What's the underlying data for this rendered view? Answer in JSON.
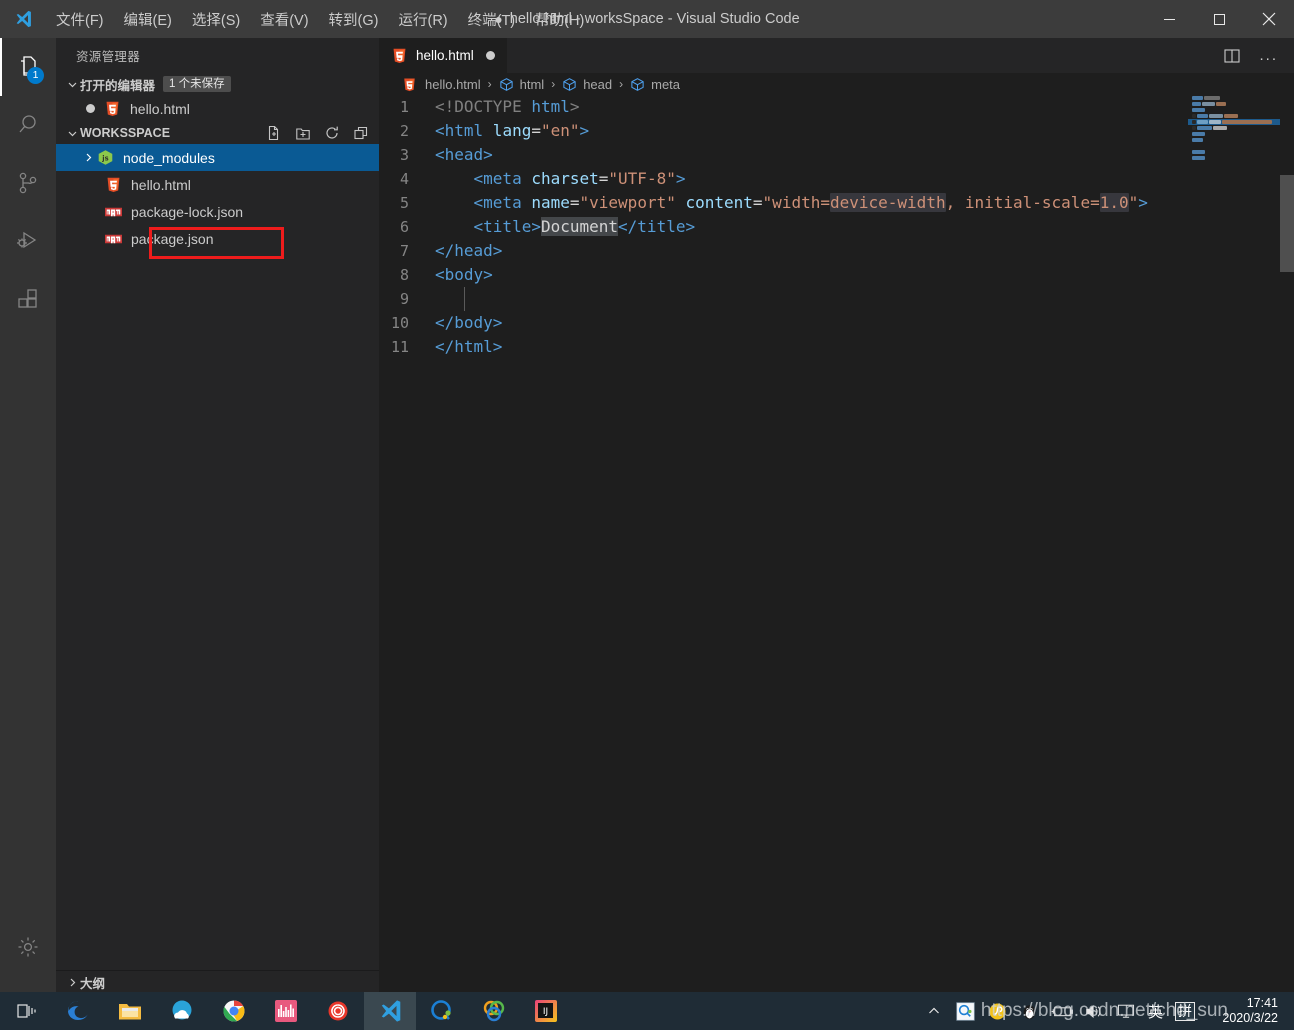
{
  "window": {
    "title": "hello.html - worksSpace - Visual Studio Code",
    "dirty_marker": "●",
    "app_icon": "vscode-logo-icon",
    "minimize_label": "最小化",
    "maximize_label": "最大化",
    "close_label": "关闭"
  },
  "menubar": {
    "items": [
      {
        "label": "文件(F)",
        "name": "menu-file"
      },
      {
        "label": "编辑(E)",
        "name": "menu-edit"
      },
      {
        "label": "选择(S)",
        "name": "menu-selection"
      },
      {
        "label": "查看(V)",
        "name": "menu-view"
      },
      {
        "label": "转到(G)",
        "name": "menu-go"
      },
      {
        "label": "运行(R)",
        "name": "menu-run"
      },
      {
        "label": "终端(T)",
        "name": "menu-terminal"
      },
      {
        "label": "帮助(H)",
        "name": "menu-help"
      }
    ]
  },
  "activitybar": {
    "items": [
      {
        "name": "activity-explorer",
        "icon": "files-icon",
        "active": true,
        "badge": "1"
      },
      {
        "name": "activity-search",
        "icon": "search-icon",
        "active": false,
        "badge": ""
      },
      {
        "name": "activity-source-control",
        "icon": "source-control-icon",
        "active": false,
        "badge": ""
      },
      {
        "name": "activity-run-debug",
        "icon": "run-debug-icon",
        "active": false,
        "badge": ""
      },
      {
        "name": "activity-extensions",
        "icon": "extensions-icon",
        "active": false,
        "badge": ""
      }
    ],
    "settings": {
      "name": "activity-settings",
      "icon": "gear-icon"
    }
  },
  "sidebar": {
    "title": "资源管理器",
    "open_editors": {
      "label": "打开的编辑器",
      "badge": "1 个未保存",
      "items": [
        {
          "label": "hello.html",
          "icon": "html5-icon",
          "unsaved": true
        }
      ]
    },
    "workspace": {
      "label": "WORKSSPACE",
      "actions": [
        {
          "name": "new-file-button",
          "icon": "new-file-icon"
        },
        {
          "name": "new-folder-button",
          "icon": "new-folder-icon"
        },
        {
          "name": "refresh-explorer-button",
          "icon": "refresh-icon"
        },
        {
          "name": "collapse-folders-button",
          "icon": "collapse-all-icon"
        }
      ],
      "items": [
        {
          "label": "node_modules",
          "icon": "node-folder-icon",
          "type": "folder",
          "selected": true,
          "expanded": false
        },
        {
          "label": "hello.html",
          "icon": "html5-icon",
          "type": "file",
          "selected": false,
          "highlighted": true
        },
        {
          "label": "package-lock.json",
          "icon": "npm-icon",
          "type": "file",
          "selected": false
        },
        {
          "label": "package.json",
          "icon": "npm-icon",
          "type": "file",
          "selected": false
        }
      ]
    },
    "outline": {
      "label": "大纲"
    }
  },
  "editor": {
    "tab": {
      "label": "hello.html",
      "icon": "html5-icon",
      "dirty": true
    },
    "actions": [
      {
        "name": "split-editor-button",
        "icon": "split-editor-icon"
      },
      {
        "name": "more-actions-button",
        "icon": "ellipsis-icon",
        "label": "..."
      }
    ],
    "breadcrumbs": [
      {
        "label": "hello.html",
        "icon": "html5-icon"
      },
      {
        "label": "html",
        "icon": "symbol-cube-icon"
      },
      {
        "label": "head",
        "icon": "symbol-cube-icon"
      },
      {
        "label": "meta",
        "icon": "symbol-cube-icon"
      }
    ],
    "lines": [
      {
        "num": "1",
        "tokens": [
          {
            "t": "<!DOCTYPE ",
            "c": "doctype"
          },
          {
            "t": "html",
            "c": "tag"
          },
          {
            "t": ">",
            "c": "doctype"
          }
        ]
      },
      {
        "num": "2",
        "tokens": [
          {
            "t": "<html",
            "c": "tag"
          },
          {
            "t": " lang",
            "c": "attr"
          },
          {
            "t": "=",
            "c": "plain"
          },
          {
            "t": "\"en\"",
            "c": "str"
          },
          {
            "t": ">",
            "c": "tag"
          }
        ]
      },
      {
        "num": "3",
        "tokens": [
          {
            "t": "<head>",
            "c": "tag"
          }
        ]
      },
      {
        "num": "4",
        "tokens": [
          {
            "t": "    <meta",
            "c": "tag"
          },
          {
            "t": " charset",
            "c": "attr"
          },
          {
            "t": "=",
            "c": "plain"
          },
          {
            "t": "\"UTF-8\"",
            "c": "str"
          },
          {
            "t": ">",
            "c": "tag"
          }
        ]
      },
      {
        "num": "5",
        "tokens": [
          {
            "t": "    <meta",
            "c": "tag"
          },
          {
            "t": " name",
            "c": "attr"
          },
          {
            "t": "=",
            "c": "plain"
          },
          {
            "t": "\"viewport\"",
            "c": "str"
          },
          {
            "t": " content",
            "c": "attr"
          },
          {
            "t": "=",
            "c": "plain"
          },
          {
            "t": "\"width=",
            "c": "str"
          },
          {
            "t": "device-width",
            "c": "str wordhl"
          },
          {
            "t": ", initial-scale=",
            "c": "str"
          },
          {
            "t": "1.0",
            "c": "str wordhl"
          },
          {
            "t": "\"",
            "c": "str"
          },
          {
            "t": ">",
            "c": "tag"
          }
        ]
      },
      {
        "num": "6",
        "tokens": [
          {
            "t": "    <title>",
            "c": "tag"
          },
          {
            "t": "Document",
            "c": "plain selhl"
          },
          {
            "t": "</title>",
            "c": "tag"
          }
        ]
      },
      {
        "num": "7",
        "tokens": [
          {
            "t": "</head>",
            "c": "tag"
          }
        ]
      },
      {
        "num": "8",
        "tokens": [
          {
            "t": "<body>",
            "c": "tag"
          }
        ]
      },
      {
        "num": "9",
        "tokens": [
          {
            "t": "",
            "c": "plain"
          }
        ],
        "indent_guide": true
      },
      {
        "num": "10",
        "tokens": [
          {
            "t": "</body>",
            "c": "tag"
          }
        ]
      },
      {
        "num": "11",
        "tokens": [
          {
            "t": "</html>",
            "c": "tag"
          }
        ]
      }
    ],
    "minimap": {
      "name": "minimap",
      "rows": [
        {
          "blocks": [
            {
              "w": 11,
              "c": "#4a7ba8"
            },
            {
              "w": 16,
              "c": "#6b6b6b"
            }
          ]
        },
        {
          "blocks": [
            {
              "w": 9,
              "c": "#4a7ba8"
            },
            {
              "w": 13,
              "c": "#7a8fa0"
            },
            {
              "w": 10,
              "c": "#9a6f52"
            }
          ]
        },
        {
          "blocks": [
            {
              "w": 13,
              "c": "#4a7ba8"
            }
          ]
        },
        {
          "blocks": [
            {
              "w": 4,
              "c": "#2a2a2a"
            },
            {
              "w": 11,
              "c": "#4a7ba8"
            },
            {
              "w": 14,
              "c": "#7a8fa0"
            },
            {
              "w": 14,
              "c": "#9a6f52"
            }
          ]
        },
        {
          "selected": true,
          "blocks": [
            {
              "w": 4,
              "c": "#2a2a2a"
            },
            {
              "w": 11,
              "c": "#6d9ec4"
            },
            {
              "w": 12,
              "c": "#9fb5c6"
            },
            {
              "w": 50,
              "c": "#9a6f52"
            }
          ]
        },
        {
          "blocks": [
            {
              "w": 4,
              "c": "#2a2a2a"
            },
            {
              "w": 15,
              "c": "#4a7ba8"
            },
            {
              "w": 14,
              "c": "#a9a9a9"
            }
          ]
        },
        {
          "blocks": [
            {
              "w": 13,
              "c": "#4a7ba8"
            }
          ]
        },
        {
          "blocks": [
            {
              "w": 11,
              "c": "#4a7ba8"
            }
          ]
        },
        {
          "blocks": []
        },
        {
          "blocks": [
            {
              "w": 13,
              "c": "#4a7ba8"
            }
          ]
        },
        {
          "blocks": [
            {
              "w": 13,
              "c": "#4a7ba8"
            }
          ]
        }
      ]
    }
  },
  "taskbar": {
    "items": [
      {
        "name": "taskview-button",
        "icon": "task-view-icon"
      },
      {
        "name": "taskbar-edge",
        "icon": "edge-icon"
      },
      {
        "name": "taskbar-file-explorer",
        "icon": "file-explorer-icon"
      },
      {
        "name": "taskbar-weather-app",
        "icon": "cloud-app-icon"
      },
      {
        "name": "taskbar-chrome",
        "icon": "chrome-icon"
      },
      {
        "name": "taskbar-bilibili",
        "icon": "bilibili-icon"
      },
      {
        "name": "taskbar-snail-app",
        "icon": "snail-icon"
      },
      {
        "name": "taskbar-vscode",
        "icon": "vscode-icon",
        "active": true
      },
      {
        "name": "taskbar-qq-browser",
        "icon": "qq-browser-icon"
      },
      {
        "name": "taskbar-colored-app",
        "icon": "ring-app-icon"
      },
      {
        "name": "taskbar-intellij",
        "icon": "intellij-idea-icon"
      }
    ],
    "tray": [
      {
        "name": "tray-expand-button",
        "icon": "chevron-up-icon"
      },
      {
        "name": "tray-qq-browser",
        "icon": "qq-browser-tray-icon"
      },
      {
        "name": "tray-wechat-pay",
        "icon": "yellow-circle-icon"
      },
      {
        "name": "tray-qq",
        "icon": "penguin-icon"
      },
      {
        "name": "tray-battery",
        "icon": "battery-icon"
      },
      {
        "name": "tray-volume",
        "icon": "volume-icon"
      },
      {
        "name": "tray-network",
        "icon": "monitor-icon"
      },
      {
        "name": "tray-ime-mode",
        "icon": "ime-english-icon",
        "label": "英"
      },
      {
        "name": "tray-ime-pinyin",
        "icon": "ime-pinyin-icon",
        "label": "拼"
      }
    ],
    "clock": {
      "time": "17:41",
      "date": "2020/3/22"
    },
    "watermark": "https://blog.csdn.net/chd_sun"
  }
}
